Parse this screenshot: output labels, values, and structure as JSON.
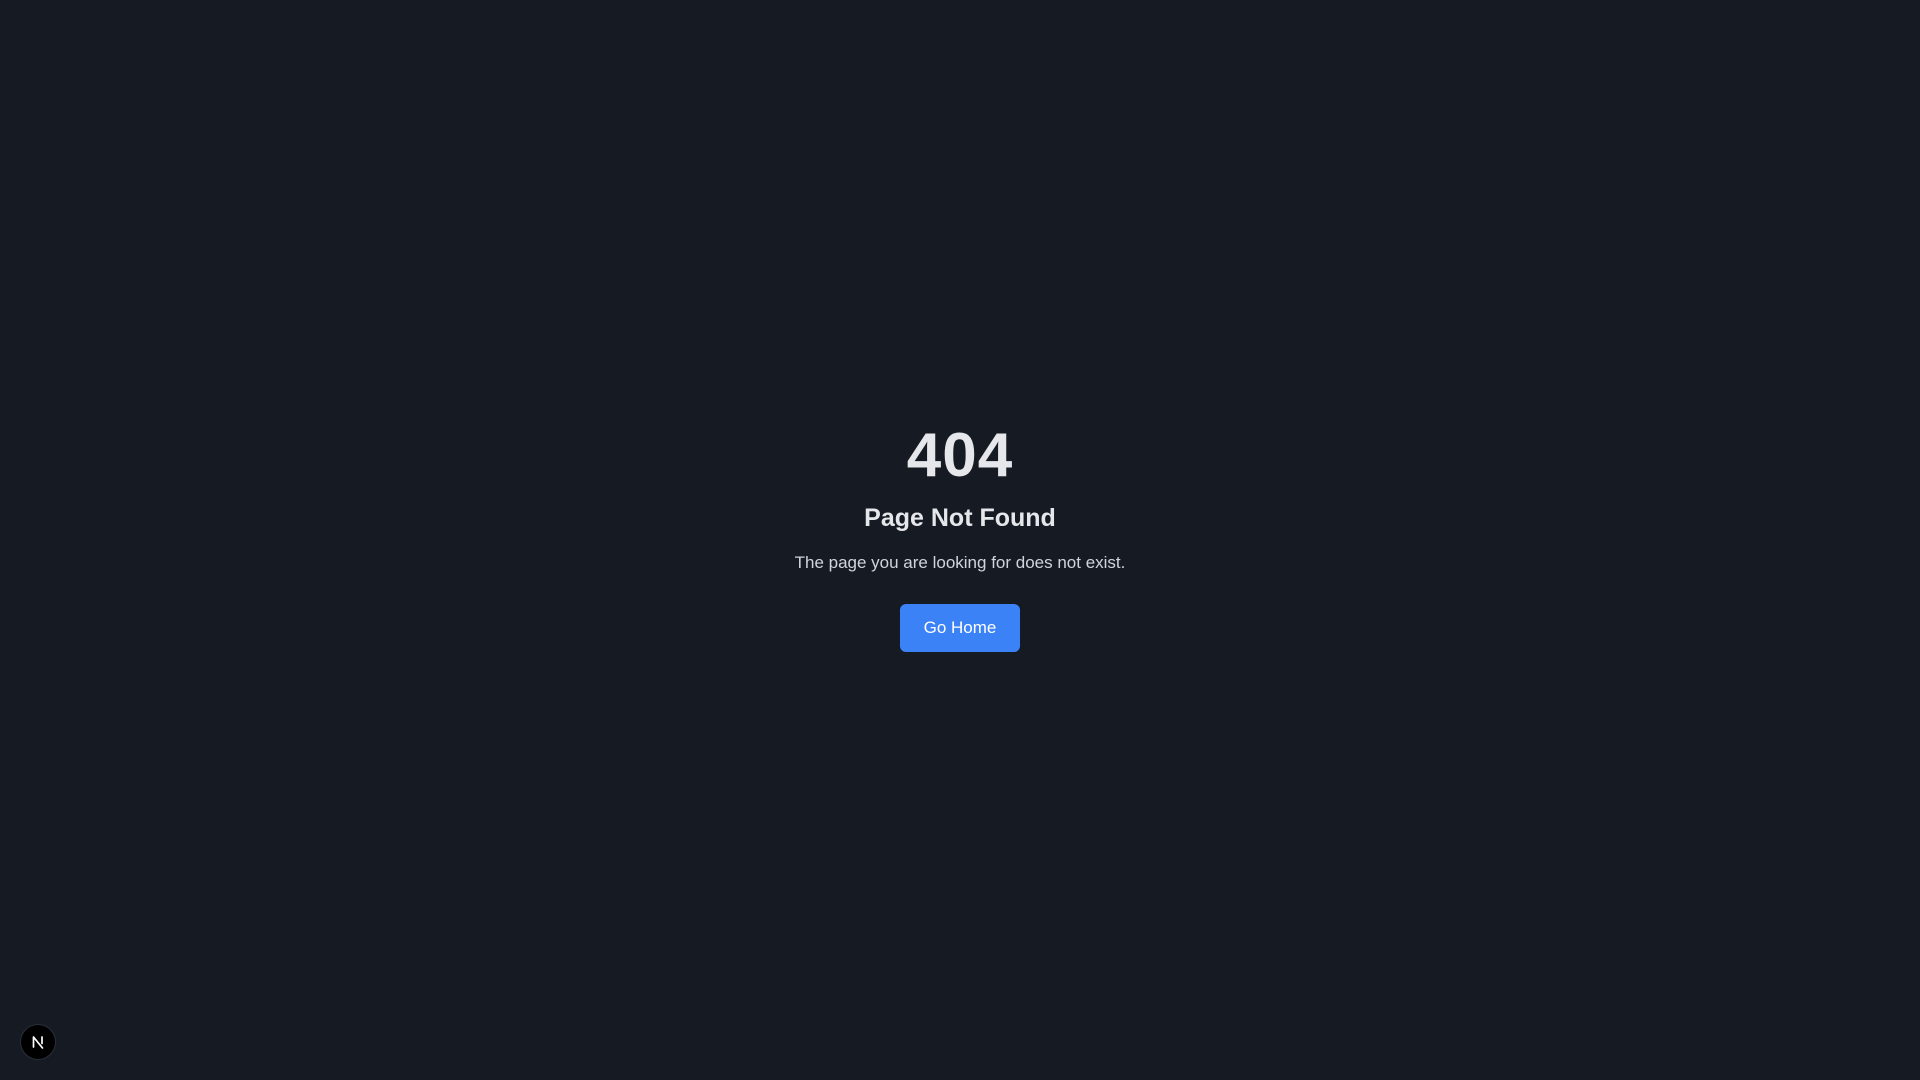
{
  "page": {
    "code": "404",
    "title": "Page Not Found",
    "message": "The page you are looking for does not exist.",
    "home_button_label": "Go Home"
  },
  "dev_badge": {
    "icon": "nextjs-logo-icon"
  },
  "colors": {
    "background": "#161a23",
    "text_primary": "#e5e7eb",
    "text_secondary": "#d1d5db",
    "accent": "#3b82f6"
  }
}
